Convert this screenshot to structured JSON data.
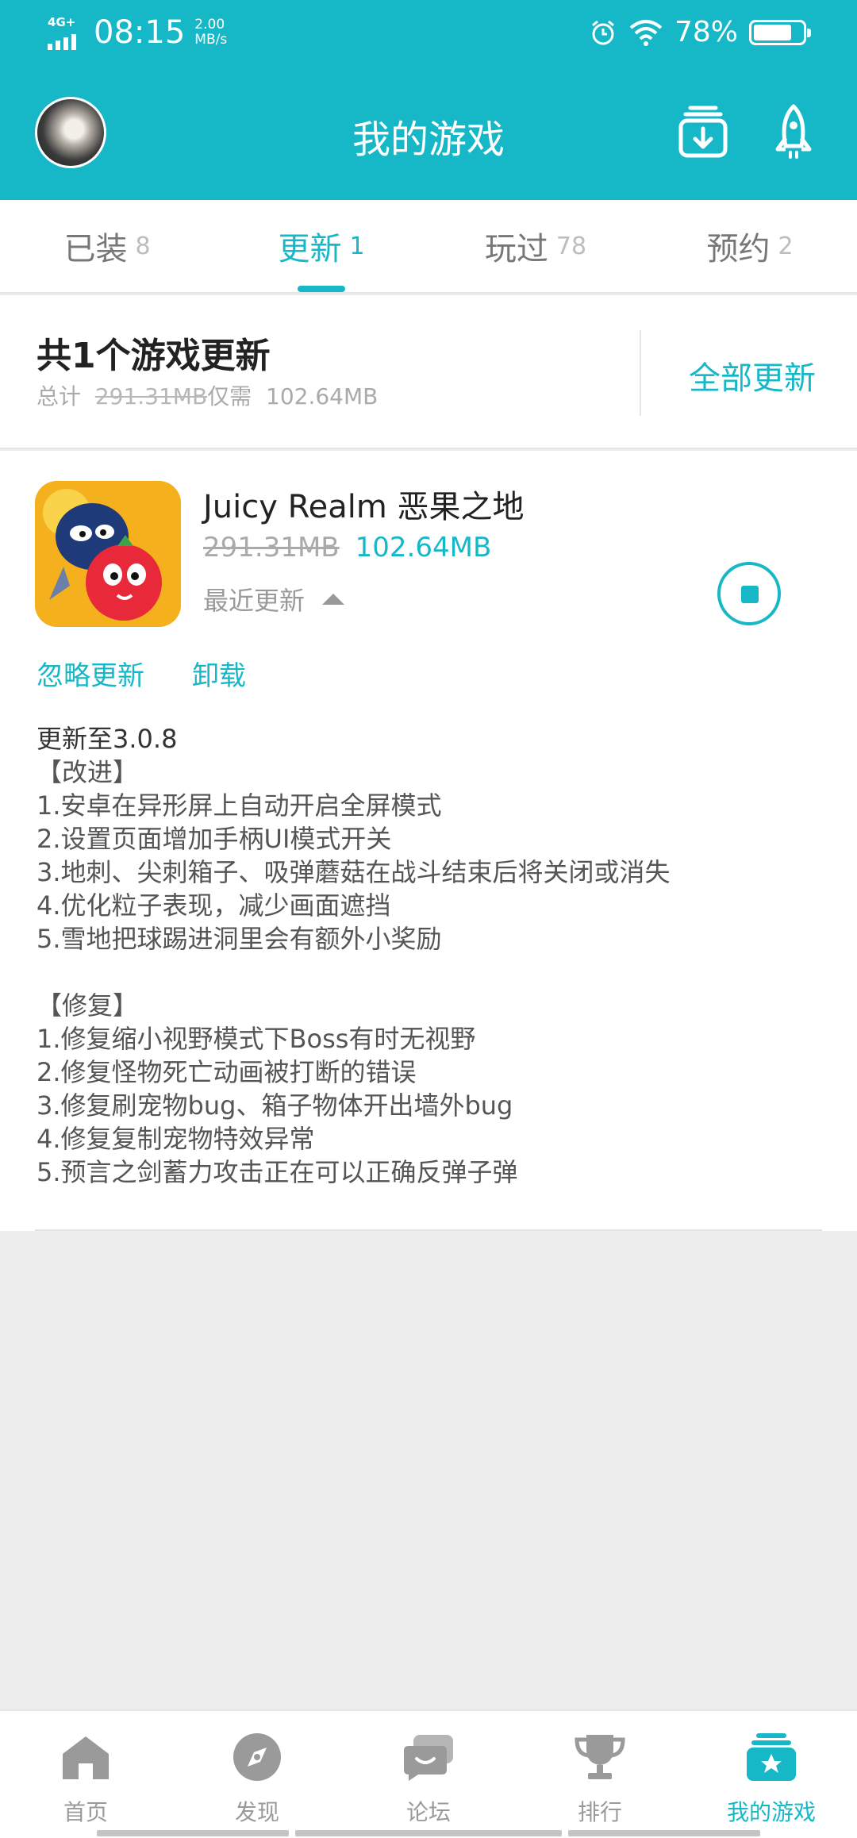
{
  "status_bar": {
    "network": "4G+",
    "time": "08:15",
    "speed_value": "2.00",
    "speed_unit": "MB/s",
    "battery_percent": "78%"
  },
  "header": {
    "title": "我的游戏"
  },
  "tabs": [
    {
      "label": "已装",
      "count": "8"
    },
    {
      "label": "更新",
      "count": "1"
    },
    {
      "label": "玩过",
      "count": "78"
    },
    {
      "label": "预约",
      "count": "2"
    }
  ],
  "summary": {
    "title": "共1个游戏更新",
    "total_prefix": "总计",
    "old_size": "291.31MB",
    "only_prefix": "仅需",
    "new_size": "102.64MB",
    "update_all_label": "全部更新"
  },
  "game": {
    "name": "Juicy Realm 恶果之地",
    "old_size": "291.31MB",
    "new_size": "102.64MB",
    "recent_label": "最近更新",
    "ignore_label": "忽略更新",
    "uninstall_label": "卸载",
    "changelog": [
      "更新至3.0.8",
      "【改进】",
      "1.安卓在异形屏上自动开启全屏模式",
      "2.设置页面增加手柄UI模式开关",
      "3.地刺、尖刺箱子、吸弹蘑菇在战斗结束后将关闭或消失",
      "4.优化粒子表现，减少画面遮挡",
      "5.雪地把球踢进洞里会有额外小奖励",
      "",
      "【修复】",
      "1.修复缩小视野模式下Boss有时无视野",
      "2.修复怪物死亡动画被打断的错误",
      "3.修复刷宠物bug、箱子物体开出墙外bug",
      "4.修复复制宠物特效异常",
      "5.预言之剑蓄力攻击正在可以正确反弹子弹"
    ]
  },
  "bottom_nav": [
    {
      "label": "首页",
      "icon": "home-icon"
    },
    {
      "label": "发现",
      "icon": "compass-icon"
    },
    {
      "label": "论坛",
      "icon": "forum-icon"
    },
    {
      "label": "排行",
      "icon": "trophy-icon"
    },
    {
      "label": "我的游戏",
      "icon": "my-games-icon"
    }
  ],
  "colors": {
    "accent": "#16b8c8",
    "inactive": "#9a9a9a"
  }
}
